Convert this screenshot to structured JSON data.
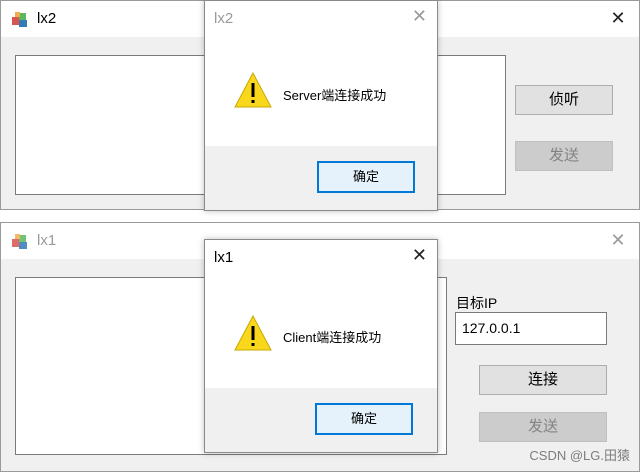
{
  "window_top": {
    "title": "lx2",
    "close_glyph": "✕",
    "listen_button": "侦听",
    "send_button": "发送"
  },
  "window_bottom": {
    "title": "lx1",
    "close_glyph": "✕",
    "target_ip_label": "目标IP",
    "target_ip_value": "127.0.0.1",
    "connect_button": "连接",
    "send_button": "发送"
  },
  "dialog_top": {
    "title": "lx2",
    "close_glyph": "✕",
    "message": "Server端连接成功",
    "ok_button": "确定",
    "icon": "warning-icon"
  },
  "dialog_bottom": {
    "title": "lx1",
    "close_glyph": "✕",
    "message": "Client端连接成功",
    "ok_button": "确定",
    "icon": "warning-icon"
  },
  "watermark": "CSDN @LG.田猿",
  "colors": {
    "focus_border": "#0078d7",
    "warning_fill": "#f9d71c"
  }
}
